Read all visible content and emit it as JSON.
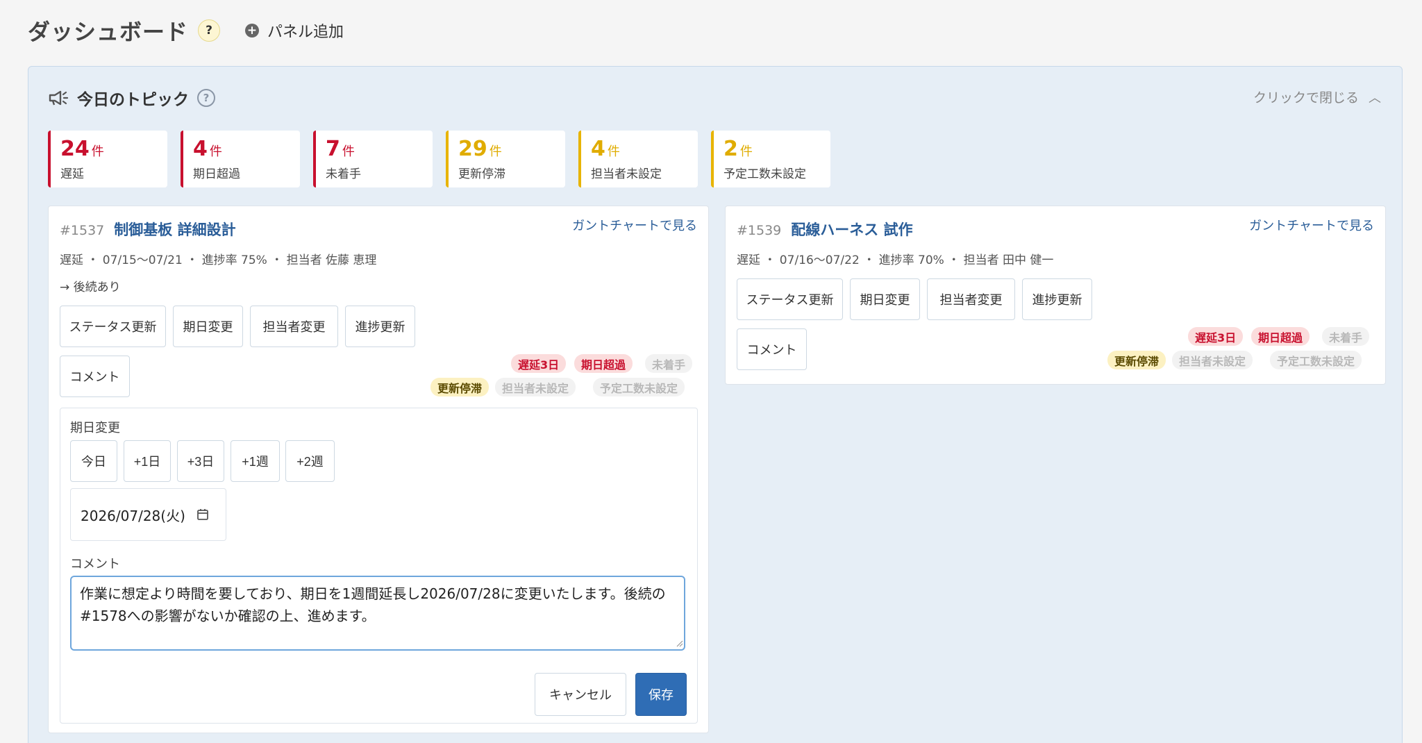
{
  "header": {
    "title": "ダッシュボード",
    "help": "?",
    "add_panel": "パネル追加"
  },
  "topic_panel": {
    "title": "今日のトピック",
    "help": "?",
    "close": "クリックで閉じる",
    "stats": [
      {
        "count": "24",
        "unit": "件",
        "label": "遅延",
        "color": "#c8102e"
      },
      {
        "count": "4",
        "unit": "件",
        "label": "期日超過",
        "color": "#c8102e"
      },
      {
        "count": "7",
        "unit": "件",
        "label": "未着手",
        "color": "#c8102e"
      },
      {
        "count": "29",
        "unit": "件",
        "label": "更新停滞",
        "color": "#e0ac00"
      },
      {
        "count": "4",
        "unit": "件",
        "label": "担当者未設定",
        "color": "#e0ac00"
      },
      {
        "count": "2",
        "unit": "件",
        "label": "予定工数未設定",
        "color": "#e0ac00"
      }
    ]
  },
  "actions": {
    "status": "ステータス更新",
    "due": "期日変更",
    "assignee": "担当者変更",
    "progress": "進捗更新",
    "comment": "コメント"
  },
  "tasks": [
    {
      "id": "#1537",
      "name": "制御基板 詳細設計",
      "gantt": "ガントチャートで見る",
      "meta": "遅延 ・ 07/15〜07/21 ・ 進捗率 75% ・ 担当者 佐藤 恵理",
      "successor": "→ 後続あり",
      "badges": [
        "遅延3日",
        "期日超過",
        "未着手",
        "更新停滞",
        "担当者未設定",
        "予定工数未設定"
      ]
    },
    {
      "id": "#1539",
      "name": "配線ハーネス 試作",
      "gantt": "ガントチャートで見る",
      "meta": "遅延 ・ 07/16〜07/22 ・ 進捗率 70% ・ 担当者 田中 健一",
      "badges": [
        "遅延3日",
        "期日超過",
        "未着手",
        "更新停滞",
        "担当者未設定",
        "予定工数未設定"
      ]
    }
  ],
  "editor": {
    "due_label": "期日変更",
    "quick": [
      "今日",
      "+1日",
      "+3日",
      "+1週",
      "+2週"
    ],
    "date": "2026/07/28(火)",
    "comment_label": "コメント",
    "comment": "作業に想定より時間を要しており、期日を1週間延長し2026/07/28に変更いたします。後続の#1578への影響がないか確認の上、進めます。",
    "cancel": "キャンセル",
    "save": "保存"
  }
}
